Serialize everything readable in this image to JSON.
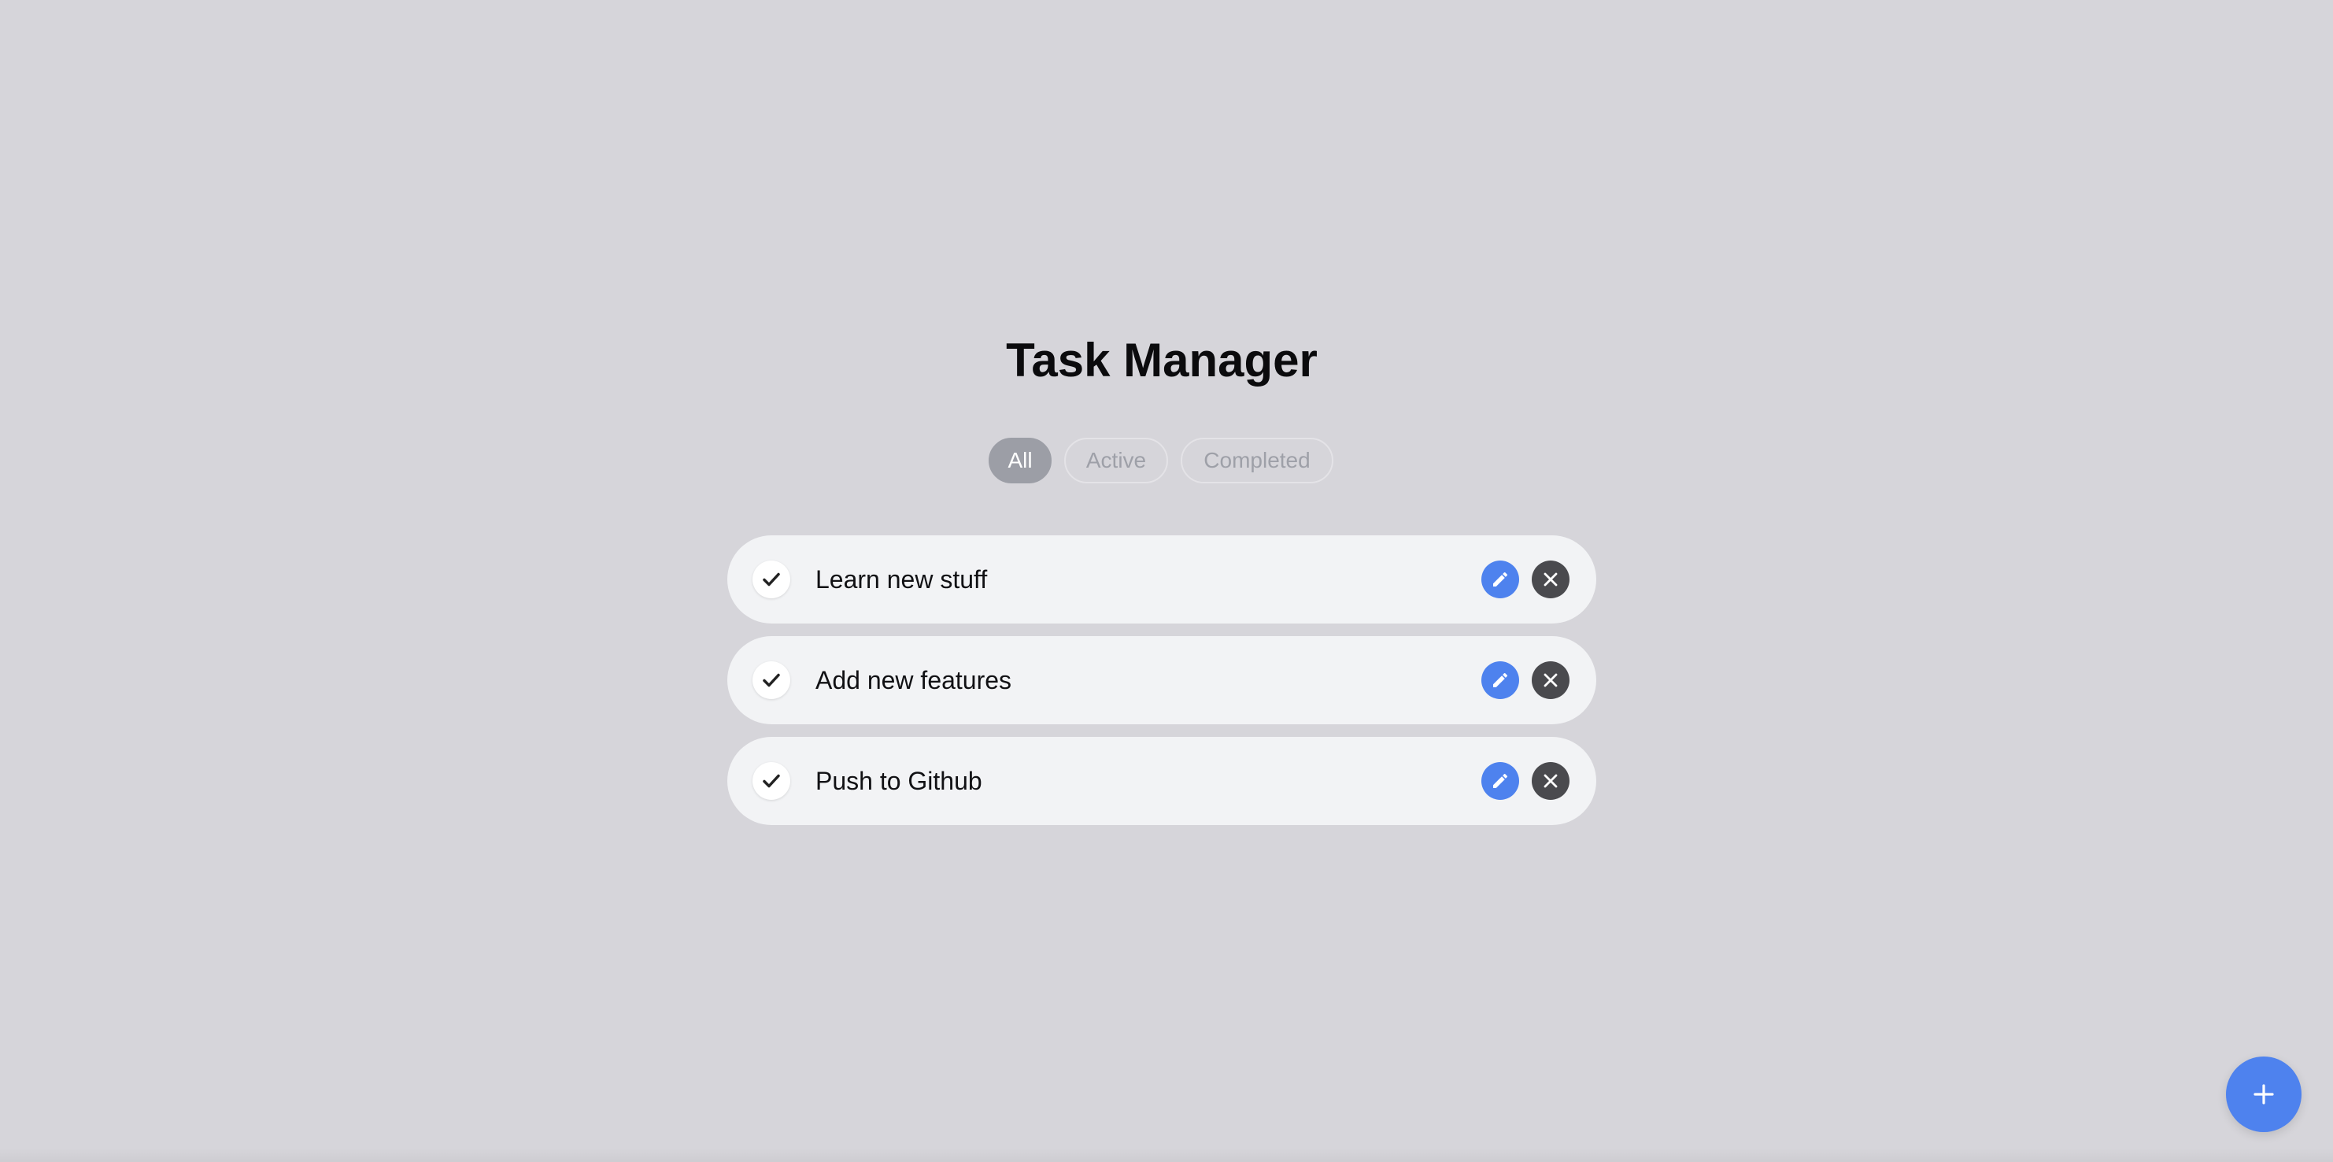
{
  "app": {
    "title": "Task Manager"
  },
  "filters": [
    {
      "label": "All",
      "selected": true
    },
    {
      "label": "Active",
      "selected": false
    },
    {
      "label": "Completed",
      "selected": false
    }
  ],
  "tasks": [
    {
      "text": "Learn new stuff"
    },
    {
      "text": "Add new features"
    },
    {
      "text": "Push to Github"
    }
  ],
  "icons": {
    "check": "check-icon",
    "edit": "pencil-icon",
    "delete": "close-icon",
    "add": "plus-icon"
  },
  "colors": {
    "background": "#d6d5da",
    "card": "#f2f3f5",
    "accent": "#4e82ee",
    "delete": "#4a4a4e",
    "filter_selected": "#9c9ea6"
  }
}
